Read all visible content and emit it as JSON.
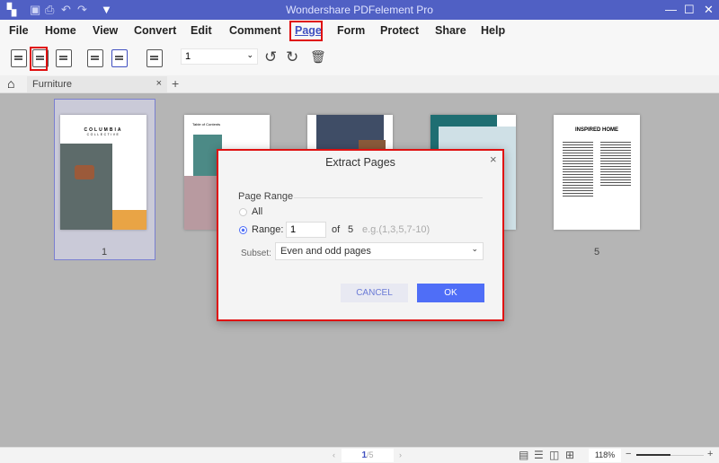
{
  "app": {
    "title": "Wondershare PDFelement Pro",
    "accent": "#5060c4"
  },
  "menu": [
    "File",
    "Home",
    "View",
    "Convert",
    "Edit",
    "Comment",
    "Page",
    "Form",
    "Protect",
    "Share",
    "Help"
  ],
  "active_menu": "Page",
  "toolbar": {
    "page_select_value": "1",
    "icons": [
      "replace-page-icon",
      "extract-page-icon",
      "insert-page-icon",
      "split-page-icon",
      "page-labels-icon",
      "page-boxes-icon",
      "rotate-left-icon",
      "rotate-right-icon",
      "delete-page-icon"
    ]
  },
  "tabs": [
    {
      "label": "Furniture",
      "close": "×"
    }
  ],
  "add_tab": "+",
  "thumbnails": [
    {
      "label": "1",
      "title": "COLUMBIA",
      "subtitle": "COLLECTIVE",
      "selected": true
    },
    {
      "label": "",
      "title": "Table of Contents"
    },
    {
      "label": ""
    },
    {
      "label": ""
    },
    {
      "label": "5",
      "title": "INSPIRED HOME"
    }
  ],
  "dialog": {
    "title": "Extract Pages",
    "close": "×",
    "section": "Page Range",
    "all_label": "All",
    "range_label": "Range:",
    "range_value": "1",
    "of_label": "of",
    "total": "5",
    "hint": "e.g.(1,3,5,7-10)",
    "subset_label": "Subset:",
    "subset_value": "Even and odd pages",
    "cancel": "CANCEL",
    "ok": "OK",
    "selected_option": "Range"
  },
  "status": {
    "page_current": "1",
    "page_total": "/5",
    "zoom": "118%",
    "minus": "−",
    "plus": "+",
    "prev": "‹",
    "next": "›",
    "zoom_level_fraction": 0.5
  }
}
